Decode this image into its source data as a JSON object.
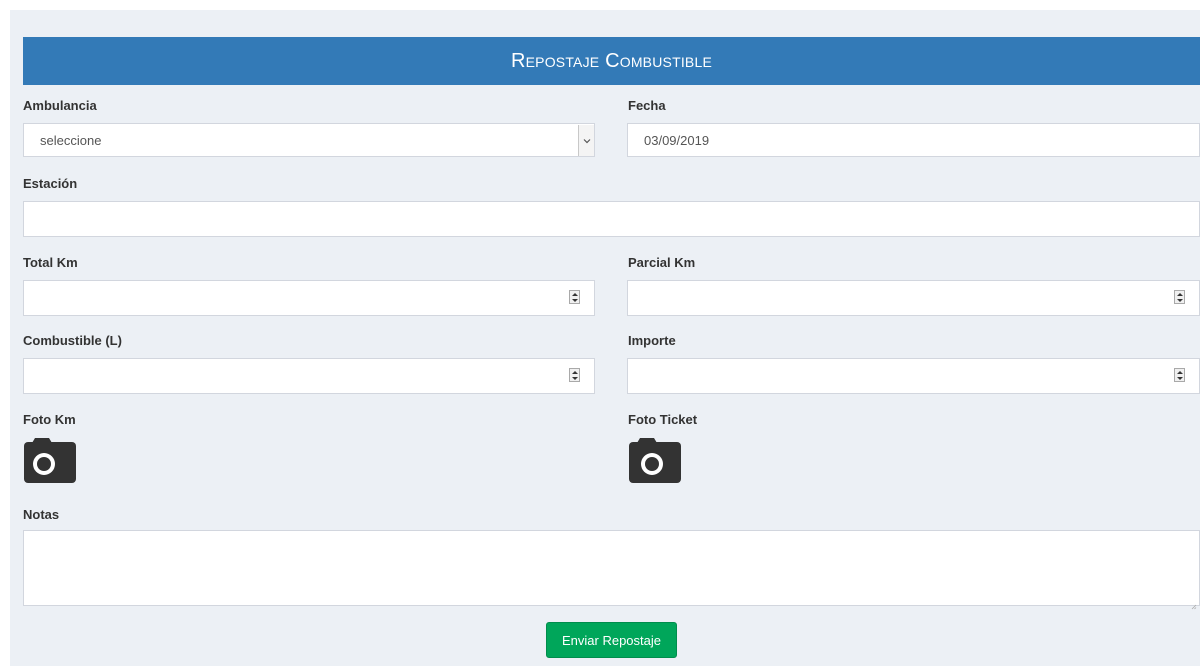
{
  "form": {
    "title": "Repostaje Combustible",
    "ambulancia": {
      "label": "Ambulancia",
      "value": "seleccione"
    },
    "fecha": {
      "label": "Fecha",
      "value": "03/09/2019"
    },
    "estacion": {
      "label": "Estación",
      "value": ""
    },
    "total_km": {
      "label": "Total Km",
      "value": ""
    },
    "parcial_km": {
      "label": "Parcial Km",
      "value": ""
    },
    "combustible": {
      "label": "Combustible (L)",
      "value": ""
    },
    "importe": {
      "label": "Importe",
      "value": ""
    },
    "foto_km": {
      "label": "Foto Km",
      "icon": "camera-icon"
    },
    "foto_ticket": {
      "label": "Foto Ticket",
      "icon": "camera-icon"
    },
    "notas": {
      "label": "Notas",
      "value": ""
    },
    "submit_label": "Enviar Repostaje"
  },
  "colors": {
    "header": "#337ab7",
    "background": "#ecf0f5",
    "submit": "#00a65a",
    "icon": "#333333"
  }
}
